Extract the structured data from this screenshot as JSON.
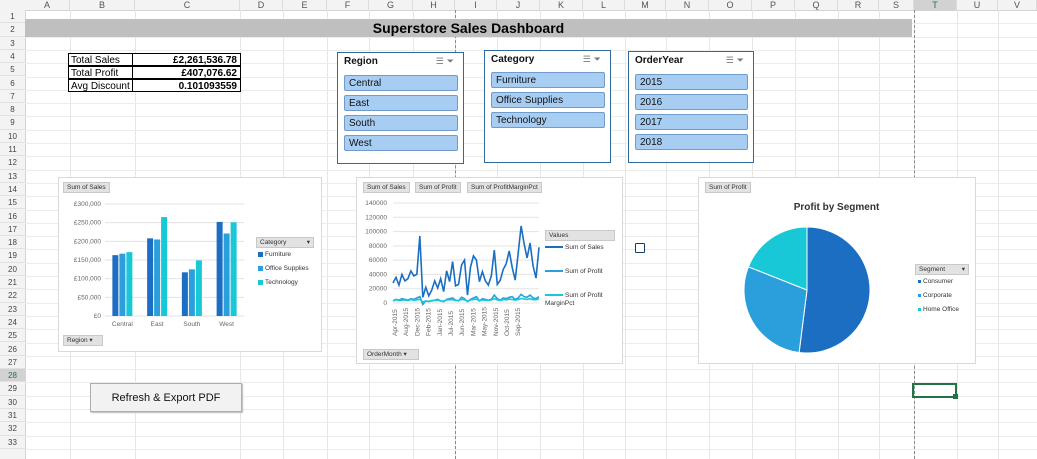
{
  "sheet": {
    "columns": [
      "A",
      "B",
      "C",
      "D",
      "E",
      "F",
      "G",
      "H",
      "I",
      "J",
      "K",
      "L",
      "M",
      "N",
      "O",
      "P",
      "Q",
      "R",
      "S",
      "T",
      "U",
      "V"
    ],
    "rows": [
      "1",
      "2",
      "3",
      "4",
      "5",
      "6",
      "7",
      "8",
      "9",
      "10",
      "11",
      "12",
      "13",
      "14",
      "15",
      "16",
      "17",
      "18",
      "19",
      "20",
      "21",
      "22",
      "23",
      "24",
      "25",
      "26",
      "27",
      "28",
      "29",
      "30",
      "31",
      "32",
      "33"
    ],
    "selected_column": "T",
    "selected_row": "28"
  },
  "dashboard_title": "Superstore Sales Dashboard",
  "kpis": [
    {
      "label": "Total Sales",
      "value": "£2,261,536.78"
    },
    {
      "label": "Total Profit",
      "value": "£407,076.62"
    },
    {
      "label": "Avg Discount",
      "value": "0.101093559"
    }
  ],
  "slicers": {
    "region": {
      "title": "Region",
      "items": [
        "Central",
        "East",
        "South",
        "West"
      ]
    },
    "category": {
      "title": "Category",
      "items": [
        "Furniture",
        "Office Supplies",
        "Technology"
      ]
    },
    "orderyear": {
      "title": "OrderYear",
      "items": [
        "2015",
        "2016",
        "2017",
        "2018"
      ]
    }
  },
  "sales_chart": {
    "field_button": "Sum of Sales",
    "axis_button": "Region",
    "legend_button": "Category",
    "legend": [
      "Furniture",
      "Office Supplies",
      "Technology"
    ],
    "colors": [
      "#1b6ec2",
      "#2b9fdc",
      "#18c8d6"
    ],
    "y_ticks": [
      "£300,000",
      "£250,000",
      "£200,000",
      "£150,000",
      "£100,000",
      "£50,000",
      "£0"
    ]
  },
  "trend_chart": {
    "field_buttons": [
      "Sum of Sales",
      "Sum of Profit",
      "Sum of ProfitMarginPct"
    ],
    "axis_button": "OrderMonth",
    "legend_title": "Values",
    "legend": [
      "Sum of Sales",
      "Sum of Profit",
      "Sum of Profit MarginPct"
    ],
    "colors": [
      "#1b6ec2",
      "#2b9fdc",
      "#18c8d6"
    ],
    "y_ticks": [
      "140000",
      "120000",
      "100000",
      "80000",
      "60000",
      "40000",
      "20000",
      "0"
    ]
  },
  "profit_chart": {
    "field_button": "Sum of Profit",
    "title": "Profit by Segment",
    "legend_button": "Segment",
    "legend": [
      "Consumer",
      "Corporate",
      "Home Office"
    ],
    "colors": [
      "#1b6ec2",
      "#2b9fdc",
      "#18c8d6"
    ]
  },
  "chart_data": [
    {
      "type": "bar",
      "title": "",
      "categories": [
        "Central",
        "East",
        "South",
        "West"
      ],
      "series": [
        {
          "name": "Furniture",
          "values": [
            163000,
            208000,
            117000,
            252000
          ]
        },
        {
          "name": "Office Supplies",
          "values": [
            167000,
            205000,
            125000,
            221000
          ]
        },
        {
          "name": "Technology",
          "values": [
            171000,
            265000,
            149000,
            251000
          ]
        }
      ],
      "ylim": [
        0,
        300000
      ],
      "grid": true,
      "legend_position": "right"
    },
    {
      "type": "line",
      "title": "",
      "x": [
        "Apr-2015",
        "Aug-2015",
        "Dec-2015",
        "Feb-2015",
        "Jan-2015",
        "Jul-2015",
        "Jun-2015",
        "Mar-2015",
        "May-2015",
        "Nov-2015",
        "Oct-2015",
        "Sep-2015"
      ],
      "series": [
        {
          "name": "Sum of Sales",
          "values": [
            28000,
            36000,
            25000,
            40000,
            31000,
            34000,
            45000,
            38000,
            40000,
            94000,
            8000,
            22000,
            10000,
            18000,
            31000,
            21000,
            34000,
            16000,
            45000,
            30000,
            58000,
            24000,
            26000,
            53000,
            60000,
            11000,
            50000,
            66000,
            60000,
            30000,
            44000,
            31000,
            25000,
            38000,
            74000,
            26000,
            32000,
            47000,
            55000,
            73000,
            50000,
            32000,
            69000,
            108000,
            83000,
            63000,
            84000,
            52000,
            35000,
            78000
          ]
        },
        {
          "name": "Sum of Profit",
          "values": [
            3000,
            5000,
            4000,
            6000,
            5000,
            4000,
            6000,
            5000,
            7000,
            9000,
            -2000,
            3000,
            2000,
            3000,
            4000,
            5000,
            3000,
            2000,
            5000,
            6000,
            7000,
            4000,
            3000,
            8000,
            6000,
            2000,
            5000,
            7000,
            9000,
            3000,
            6000,
            5000,
            4000,
            5000,
            11000,
            6000,
            4000,
            7000,
            6000,
            8000,
            9000,
            5000,
            7000,
            12000,
            9000,
            8000,
            11000,
            7000,
            6000,
            9000
          ]
        },
        {
          "name": "Sum of ProfitMarginPct",
          "values": [
            100,
            150,
            120,
            130,
            140,
            110,
            160,
            130,
            150,
            170,
            50,
            90,
            80,
            110,
            120,
            130,
            100,
            90,
            140,
            150,
            160,
            120,
            110,
            170,
            150,
            90,
            140,
            160,
            180,
            110,
            140,
            130,
            120,
            140,
            200,
            150,
            120,
            160,
            150,
            180,
            170,
            130,
            160,
            210,
            190,
            170,
            200,
            160,
            150,
            190
          ]
        }
      ],
      "ylim": [
        0,
        140000
      ],
      "grid": true,
      "legend_position": "right"
    },
    {
      "type": "pie",
      "title": "Profit by Segment",
      "categories": [
        "Consumer",
        "Corporate",
        "Home Office"
      ],
      "values": [
        52,
        29,
        19
      ],
      "legend_position": "right"
    }
  ]
}
